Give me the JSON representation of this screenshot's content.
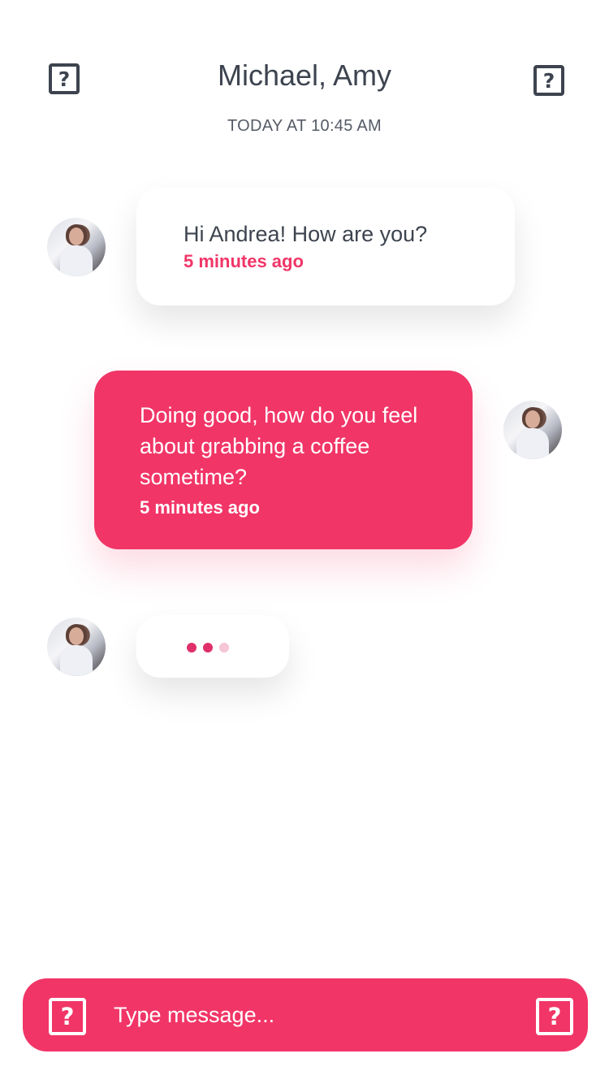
{
  "header": {
    "title": "Michael, Amy",
    "subtitle": "TODAY AT 10:45 AM",
    "left_icon": "unknown-icon",
    "right_icon": "unknown-icon",
    "icon_glyph": "?"
  },
  "messages": [
    {
      "direction": "incoming",
      "text": "Hi Andrea! How are you?",
      "time": "5 minutes ago"
    },
    {
      "direction": "outgoing",
      "text": "Doing good, how do you feel about grabbing a coffee sometime?",
      "time": "5 minutes ago"
    }
  ],
  "typing_indicator": {
    "dot_colors": [
      "#e0306a",
      "#e0306a",
      "#f6c6d6"
    ]
  },
  "composer": {
    "placeholder": "Type message...",
    "left_icon": "unknown-icon",
    "right_icon": "unknown-icon",
    "icon_glyph": "?"
  },
  "colors": {
    "accent": "#f13567",
    "text": "#3d444f",
    "background": "#ffffff"
  }
}
